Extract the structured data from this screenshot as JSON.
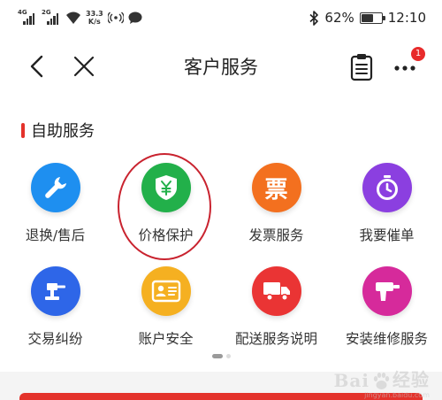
{
  "status_bar": {
    "signal_1_label": "4G",
    "signal_2_label": "2G",
    "speed_value": "33.3",
    "speed_unit": "K/s",
    "battery_percent": "62%",
    "battery_level": 0.62,
    "time": "12:10"
  },
  "nav": {
    "title": "客户服务",
    "notification_count": "1"
  },
  "section": {
    "title": "自助服务"
  },
  "services": [
    {
      "label": "退换/售后",
      "icon": "wrench-icon",
      "color": "#1e8ff0"
    },
    {
      "label": "价格保护",
      "icon": "yuan-shield-icon",
      "color": "#22b04a"
    },
    {
      "label": "发票服务",
      "icon": "invoice-icon",
      "color": "#f3701f",
      "glyph": "票"
    },
    {
      "label": "我要催单",
      "icon": "stopwatch-icon",
      "color": "#8b3fe0"
    },
    {
      "label": "交易纠纷",
      "icon": "gavel-icon",
      "color": "#2e66e8"
    },
    {
      "label": "账户安全",
      "icon": "id-card-icon",
      "color": "#f5b021"
    },
    {
      "label": "配送服务说明",
      "icon": "truck-icon",
      "color": "#ea3434"
    },
    {
      "label": "安装维修服务",
      "icon": "drill-icon",
      "color": "#d62a9b"
    }
  ],
  "pager": {
    "current_page": 1,
    "total_pages": 2
  },
  "watermark": {
    "text": "Bai",
    "suffix": "经验",
    "sub": "jingyan.baidu.com"
  }
}
